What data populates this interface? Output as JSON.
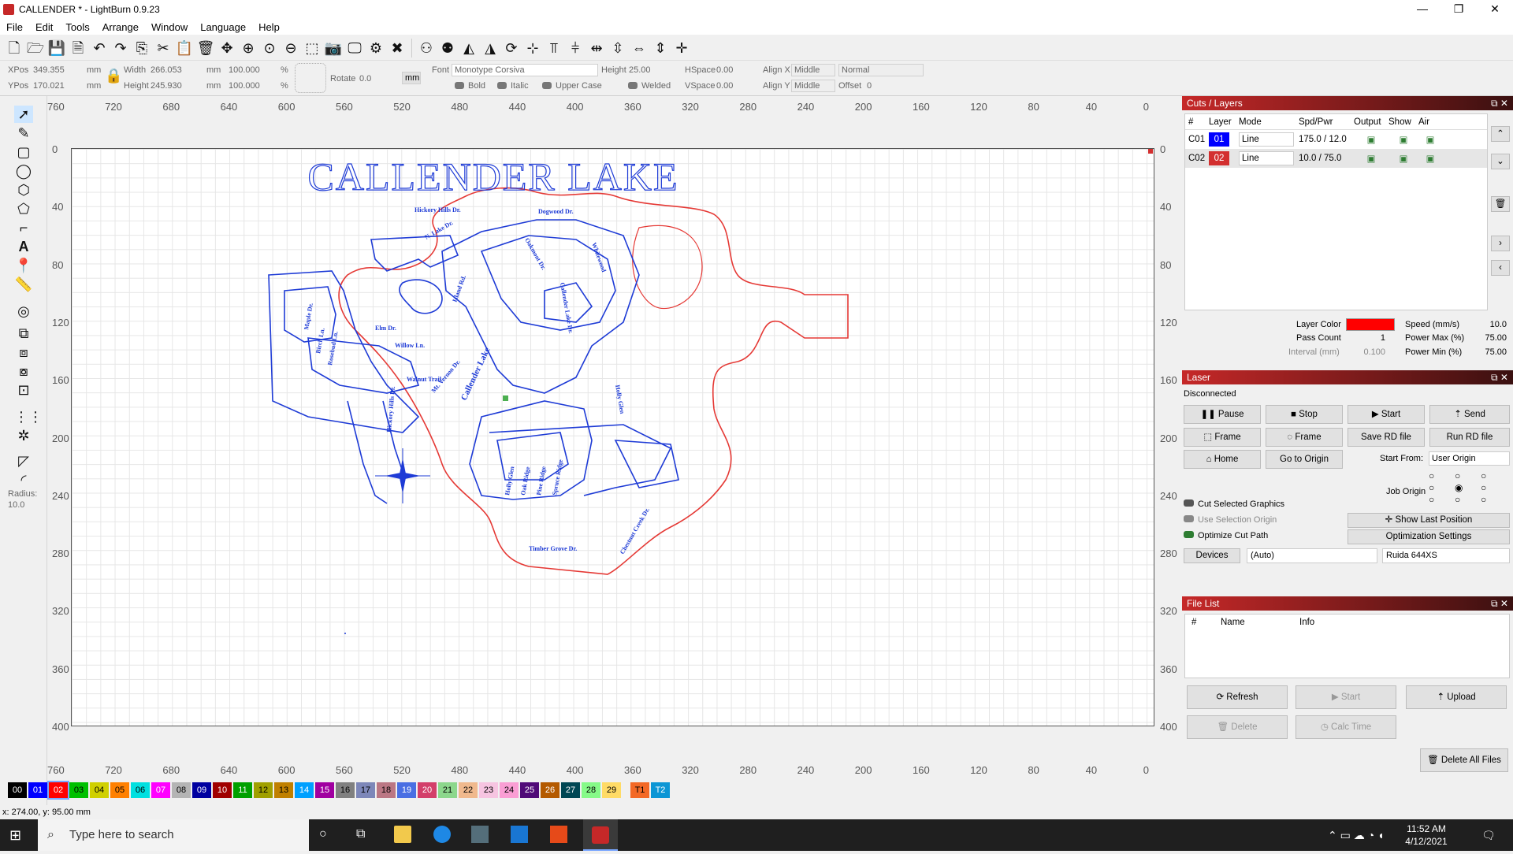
{
  "window": {
    "title": "CALLENDER * - LightBurn 0.9.23",
    "min": "—",
    "max": "❐",
    "close": "✕"
  },
  "menu": [
    "File",
    "Edit",
    "Tools",
    "Arrange",
    "Window",
    "Language",
    "Help"
  ],
  "props": {
    "xpos_label": "XPos",
    "xpos": "349.355",
    "ypos_label": "YPos",
    "ypos": "170.021",
    "unit_mm": "mm",
    "width_label": "Width",
    "width": "266.053",
    "height_label": "Height",
    "height": "245.930",
    "scale_w": "100.000",
    "scale_h": "100.000",
    "pct": "%",
    "rotate_label": "Rotate",
    "rotate": "0.0",
    "mm_button": "mm",
    "font_label": "Font",
    "font": "Monotype Corsiva",
    "text_height_label": "Height",
    "text_height": "25.00",
    "hspace_label": "HSpace",
    "hspace": "0.00",
    "vspace_label": "VSpace",
    "vspace": "0.00",
    "alignx_label": "Align X",
    "alignx": "Middle",
    "aligny_label": "Align Y",
    "aligny": "Middle",
    "normal": "Normal",
    "offset_label": "Offset",
    "offset": "0",
    "bold": "Bold",
    "italic": "Italic",
    "upper": "Upper Case",
    "welded": "Welded"
  },
  "ruler": {
    "x_ticks": [
      "760",
      "720",
      "680",
      "640",
      "600",
      "560",
      "520",
      "480",
      "440",
      "400",
      "360",
      "320",
      "280",
      "240",
      "200",
      "160",
      "120",
      "80",
      "40",
      "0"
    ],
    "y_ticks": [
      "0",
      "40",
      "80",
      "120",
      "160",
      "200",
      "240",
      "280",
      "320",
      "360",
      "400"
    ]
  },
  "radius": {
    "label": "Radius:",
    "value": "10.0"
  },
  "map": {
    "title": "CALLENDER LAKE",
    "streets": [
      "Hickory Hills Dr.",
      "Dogwood Dr.",
      "N. Lake Dr.",
      "Oakmont Dr.",
      "Callender Lake Dr.",
      "Whitewood",
      "Maple Dr.",
      "Birch Ln.",
      "Rosebud Ln.",
      "Elm Dr.",
      "Willow Ln.",
      "Walnut Trail",
      "Mt. Vernon Dr.",
      "Callender Lake",
      "Holly Glen",
      "Hickory Hills Dr.",
      "Holly Glen",
      "Oak Ridge",
      "Pine Ridge",
      "Spruce Ridge",
      "Timber Grove Dr.",
      "Chestnut Creek Dr.",
      "Island Rd."
    ]
  },
  "cuts": {
    "title": "Cuts / Layers",
    "columns": [
      "#",
      "Layer",
      "Mode",
      "Spd/Pwr",
      "Output",
      "Show",
      "Air"
    ],
    "rows": [
      {
        "id": "C01",
        "layer": "01",
        "mode": "Line",
        "spdpwr": "175.0 / 12.0",
        "color": "#0000ff"
      },
      {
        "id": "C02",
        "layer": "02",
        "mode": "Line",
        "spdpwr": "10.0 / 75.0",
        "color": "#d32f2f"
      }
    ],
    "layer_color_label": "Layer Color",
    "layer_color": "#ff0000",
    "speed_label": "Speed (mm/s)",
    "speed": "10.0",
    "pass_label": "Pass Count",
    "pass": "1",
    "pmax_label": "Power Max (%)",
    "pmax": "75.00",
    "interval_label": "Interval (mm)",
    "interval": "0.100",
    "pmin_label": "Power Min (%)",
    "pmin": "75.00"
  },
  "laser": {
    "title": "Laser",
    "status": "Disconnected",
    "pause": "Pause",
    "stop": "Stop",
    "start": "Start",
    "send": "Send",
    "frame1": "Frame",
    "frame2": "Frame",
    "save_rd": "Save RD file",
    "run_rd": "Run RD file",
    "home": "Home",
    "goto_origin": "Go to Origin",
    "start_from_label": "Start From:",
    "start_from": "User Origin",
    "job_origin_label": "Job Origin",
    "cut_selected": "Cut Selected Graphics",
    "use_selection": "Use Selection Origin",
    "optimize": "Optimize Cut Path",
    "show_last": "Show Last Position",
    "opt_settings": "Optimization Settings",
    "devices": "Devices",
    "device_auto": "(Auto)",
    "device_model": "Ruida 644XS"
  },
  "filelist": {
    "title": "File List",
    "columns": [
      "#",
      "Name",
      "Info"
    ],
    "refresh": "Refresh",
    "start": "Start",
    "upload": "Upload",
    "delete": "Delete",
    "calc": "Calc Time",
    "delete_all": "Delete All Files"
  },
  "palette": [
    {
      "n": "00",
      "c": "#000000",
      "t": "#fff"
    },
    {
      "n": "01",
      "c": "#0000ff",
      "t": "#fff"
    },
    {
      "n": "02",
      "c": "#ff0000",
      "t": "#fff"
    },
    {
      "n": "03",
      "c": "#00c000",
      "t": "#000"
    },
    {
      "n": "04",
      "c": "#d0d000",
      "t": "#000"
    },
    {
      "n": "05",
      "c": "#ff8000",
      "t": "#000"
    },
    {
      "n": "06",
      "c": "#00e0e0",
      "t": "#000"
    },
    {
      "n": "07",
      "c": "#ff00ff",
      "t": "#fff"
    },
    {
      "n": "08",
      "c": "#b4b4b4",
      "t": "#000"
    },
    {
      "n": "09",
      "c": "#0000a0",
      "t": "#fff"
    },
    {
      "n": "10",
      "c": "#a00000",
      "t": "#fff"
    },
    {
      "n": "11",
      "c": "#00a000",
      "t": "#fff"
    },
    {
      "n": "12",
      "c": "#a0a000",
      "t": "#000"
    },
    {
      "n": "13",
      "c": "#c08000",
      "t": "#000"
    },
    {
      "n": "14",
      "c": "#00a0ff",
      "t": "#fff"
    },
    {
      "n": "15",
      "c": "#a000a0",
      "t": "#fff"
    },
    {
      "n": "16",
      "c": "#808080",
      "t": "#000"
    },
    {
      "n": "17",
      "c": "#7d87b9",
      "t": "#000"
    },
    {
      "n": "18",
      "c": "#bb7784",
      "t": "#000"
    },
    {
      "n": "19",
      "c": "#4a6fe3",
      "t": "#fff"
    },
    {
      "n": "20",
      "c": "#d33f6a",
      "t": "#fff"
    },
    {
      "n": "21",
      "c": "#8cd78c",
      "t": "#000"
    },
    {
      "n": "22",
      "c": "#f0b98d",
      "t": "#000"
    },
    {
      "n": "23",
      "c": "#f6c4e1",
      "t": "#000"
    },
    {
      "n": "24",
      "c": "#fa9ed4",
      "t": "#000"
    },
    {
      "n": "25",
      "c": "#500a78",
      "t": "#fff"
    },
    {
      "n": "26",
      "c": "#b45a00",
      "t": "#fff"
    },
    {
      "n": "27",
      "c": "#004754",
      "t": "#fff"
    },
    {
      "n": "28",
      "c": "#86fa88",
      "t": "#000"
    },
    {
      "n": "29",
      "c": "#ffdb66",
      "t": "#000"
    },
    {
      "n": "T1",
      "c": "#f36926",
      "t": "#000"
    },
    {
      "n": "T2",
      "c": "#0c96d5",
      "t": "#fff"
    }
  ],
  "status": "x: 274.00, y: 95.00 mm",
  "taskbar": {
    "search": "Type here to search",
    "time": "11:52 AM",
    "date": "4/12/2021"
  }
}
